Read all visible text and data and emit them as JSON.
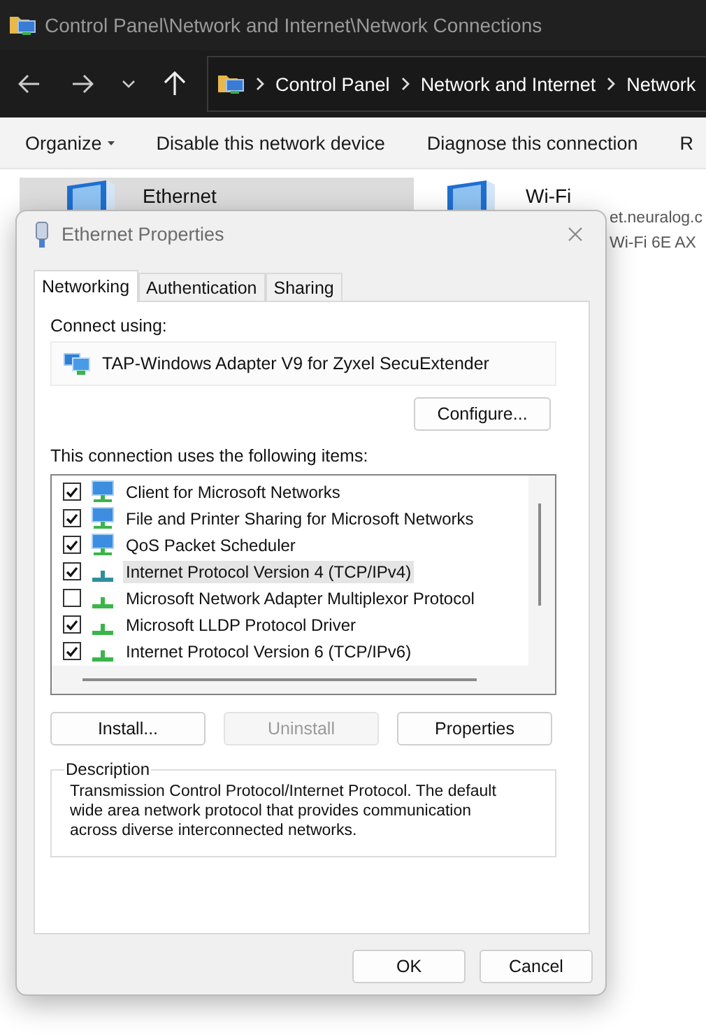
{
  "window": {
    "title": "Control Panel\\Network and Internet\\Network Connections"
  },
  "address_bar": {
    "breadcrumbs": [
      "Control Panel",
      "Network and Internet",
      "Network"
    ]
  },
  "command_bar": [
    {
      "label": "Organize",
      "kind": "menu"
    },
    {
      "label": "Disable this network device",
      "kind": "action"
    },
    {
      "label": "Diagnose this connection",
      "kind": "action"
    },
    {
      "label": "R",
      "kind": "action"
    }
  ],
  "connections": [
    {
      "name": "Ethernet",
      "selected": true
    },
    {
      "name": "Wi-Fi",
      "selected": false,
      "details": [
        "et.neuralog.c",
        "Wi-Fi 6E AX"
      ]
    }
  ],
  "dialog": {
    "title": "Ethernet Properties",
    "tabs": [
      {
        "label": "Networking",
        "selected": true
      },
      {
        "label": "Authentication",
        "selected": false
      },
      {
        "label": "Sharing",
        "selected": false
      }
    ],
    "connect_using_label": "Connect using:",
    "adapter": "TAP-Windows Adapter V9 for Zyxel SecuExtender",
    "configure_button": "Configure...",
    "items_label": "This connection uses the following items:",
    "items": [
      {
        "label": "Client for Microsoft Networks",
        "kind": "service",
        "checked": true,
        "selected": false
      },
      {
        "label": "File and Printer Sharing for Microsoft Networks",
        "kind": "service",
        "checked": true,
        "selected": false
      },
      {
        "label": "QoS Packet Scheduler",
        "kind": "service",
        "checked": true,
        "selected": false
      },
      {
        "label": "Internet Protocol Version 4 (TCP/IPv4)",
        "kind": "protocol",
        "checked": true,
        "selected": true
      },
      {
        "label": "Microsoft Network Adapter Multiplexor Protocol",
        "kind": "protocol",
        "checked": false,
        "selected": false
      },
      {
        "label": "Microsoft LLDP Protocol Driver",
        "kind": "protocol",
        "checked": true,
        "selected": false
      },
      {
        "label": "Internet Protocol Version 6 (TCP/IPv6)",
        "kind": "protocol",
        "checked": true,
        "selected": false
      }
    ],
    "item_buttons": [
      {
        "label": "Install...",
        "disabled": false
      },
      {
        "label": "Uninstall",
        "disabled": true
      },
      {
        "label": "Properties",
        "disabled": false
      }
    ],
    "description": {
      "legend": "Description",
      "text": "Transmission Control Protocol/Internet Protocol. The default wide area network protocol that provides communication across diverse interconnected networks."
    },
    "footer_buttons": [
      "OK",
      "Cancel"
    ]
  }
}
